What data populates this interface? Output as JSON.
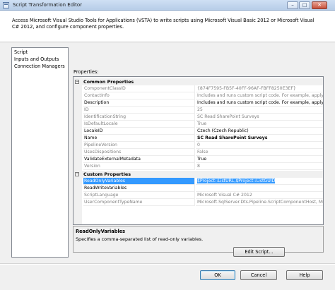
{
  "window": {
    "title": "Script Transformation Editor",
    "controls": {
      "minimize": "–",
      "maximize": "□",
      "close": "✕"
    }
  },
  "description": "Access Microsoft Visual Studio Tools for Applications (VSTA) to write scripts using Microsoft Visual Basic 2012 or Microsoft Visual C# 2012, and configure component properties.",
  "nav": {
    "items": [
      "Script",
      "Inputs and Outputs",
      "Connection Managers"
    ]
  },
  "properties": {
    "label": "Properties:",
    "categories": [
      {
        "name": "Common Properties",
        "rows": [
          {
            "name": "ComponentClassID",
            "value": "{874F7595-FB5F-40FF-96AF-FBFF8250E3EF}",
            "readonly": true
          },
          {
            "name": "ContactInfo",
            "value": "Includes and runs custom script code. For example, apply a b",
            "readonly": true
          },
          {
            "name": "Description",
            "value": "Includes and runs custom script code. For example, apply a b",
            "readonly": false
          },
          {
            "name": "ID",
            "value": "25",
            "readonly": true
          },
          {
            "name": "IdentificationString",
            "value": "SC Read SharePoint Surveys",
            "readonly": true
          },
          {
            "name": "IsDefaultLocale",
            "value": "True",
            "readonly": true
          },
          {
            "name": "LocaleID",
            "value": "Czech (Czech Republic)",
            "readonly": false
          },
          {
            "name": "Name",
            "value": "SC Read SharePoint Surveys",
            "readonly": false,
            "bold": true
          },
          {
            "name": "PipelineVersion",
            "value": "0",
            "readonly": true
          },
          {
            "name": "UsesDispositions",
            "value": "False",
            "readonly": true
          },
          {
            "name": "ValidateExternalMetadata",
            "value": "True",
            "readonly": false
          },
          {
            "name": "Version",
            "value": "8",
            "readonly": true
          }
        ]
      },
      {
        "name": "Custom Properties",
        "rows": [
          {
            "name": "ReadOnlyVariables",
            "value": "$Project::ListURL,$Project::ListGUID",
            "readonly": false,
            "selected": true
          },
          {
            "name": "ReadWriteVariables",
            "value": "",
            "readonly": false
          },
          {
            "name": "ScriptLanguage",
            "value": "Microsoft Visual C# 2012",
            "readonly": true
          },
          {
            "name": "UserComponentTypeName",
            "value": "Microsoft.SqlServer.Dts.Pipeline.ScriptComponentHost, Microsof",
            "readonly": true
          }
        ]
      }
    ]
  },
  "help": {
    "title": "ReadOnlyVariables",
    "text": "Specifies a comma-separated list of read-only variables."
  },
  "buttons": {
    "edit_script": "Edit Script...",
    "ok": "OK",
    "cancel": "Cancel",
    "help": "Help"
  }
}
